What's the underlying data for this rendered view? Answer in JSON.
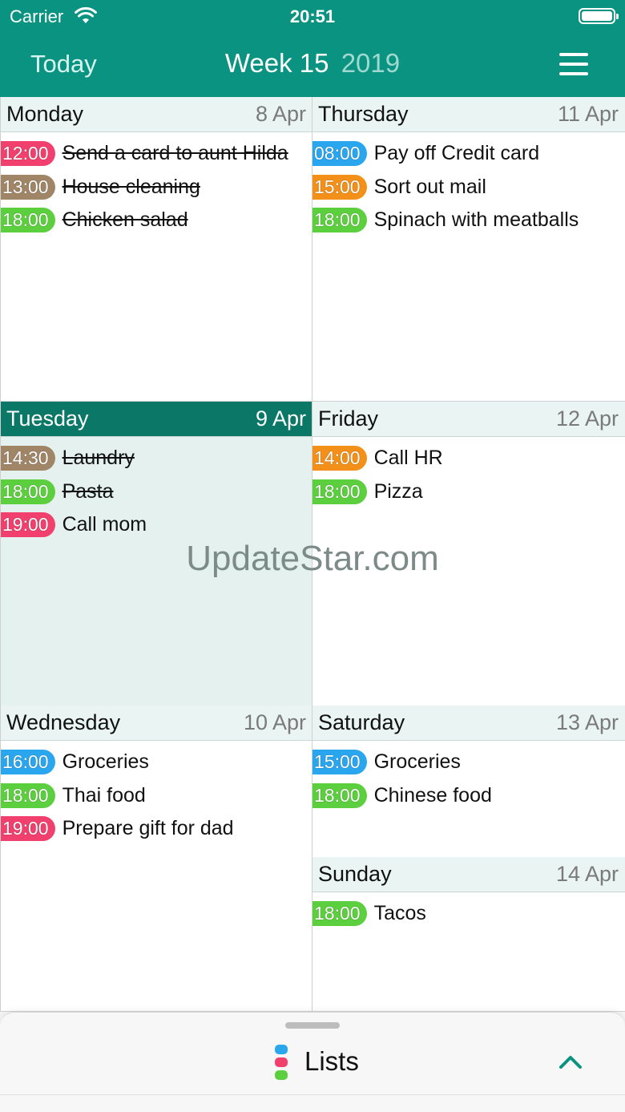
{
  "status_bar": {
    "carrier": "Carrier",
    "time": "20:51"
  },
  "nav": {
    "today": "Today",
    "week": "Week 15",
    "year": "2019"
  },
  "colors": {
    "header": "#0a9381",
    "selected_day": "#0a7767",
    "red": "#f2406e",
    "brown": "#a08566",
    "green": "#5ccf3e",
    "blue": "#2aa6ef",
    "orange": "#f39019",
    "accent": "#0a9381"
  },
  "days": [
    {
      "name": "Monday",
      "date": "8 Apr",
      "selected": false,
      "events": [
        {
          "time": "12:00",
          "title": "Send a card to aunt Hilda",
          "color": "#f2406e",
          "done": true
        },
        {
          "time": "13:00",
          "title": "House cleaning",
          "color": "#a08566",
          "done": true
        },
        {
          "time": "18:00",
          "title": "Chicken salad",
          "color": "#5ccf3e",
          "done": true
        }
      ]
    },
    {
      "name": "Tuesday",
      "date": "9 Apr",
      "selected": true,
      "events": [
        {
          "time": "14:30",
          "title": "Laundry",
          "color": "#a08566",
          "done": true
        },
        {
          "time": "18:00",
          "title": "Pasta",
          "color": "#5ccf3e",
          "done": true
        },
        {
          "time": "19:00",
          "title": "Call mom",
          "color": "#f2406e",
          "done": false
        }
      ]
    },
    {
      "name": "Wednesday",
      "date": "10 Apr",
      "selected": false,
      "events": [
        {
          "time": "16:00",
          "title": "Groceries",
          "color": "#2aa6ef",
          "done": false
        },
        {
          "time": "18:00",
          "title": "Thai food",
          "color": "#5ccf3e",
          "done": false
        },
        {
          "time": "19:00",
          "title": "Prepare gift for dad",
          "color": "#f2406e",
          "done": false
        }
      ]
    },
    {
      "name": "Thursday",
      "date": "11 Apr",
      "selected": false,
      "events": [
        {
          "time": "08:00",
          "title": "Pay off Credit card",
          "color": "#2aa6ef",
          "done": false
        },
        {
          "time": "15:00",
          "title": "Sort out mail",
          "color": "#f39019",
          "done": false
        },
        {
          "time": "18:00",
          "title": "Spinach with meatballs",
          "color": "#5ccf3e",
          "done": false
        }
      ]
    },
    {
      "name": "Friday",
      "date": "12 Apr",
      "selected": false,
      "events": [
        {
          "time": "14:00",
          "title": "Call HR",
          "color": "#f39019",
          "done": false
        },
        {
          "time": "18:00",
          "title": "Pizza",
          "color": "#5ccf3e",
          "done": false
        }
      ]
    },
    {
      "name": "Saturday",
      "date": "13 Apr",
      "selected": false,
      "events": [
        {
          "time": "15:00",
          "title": "Groceries",
          "color": "#2aa6ef",
          "done": false
        },
        {
          "time": "18:00",
          "title": "Chinese food",
          "color": "#5ccf3e",
          "done": false
        }
      ]
    },
    {
      "name": "Sunday",
      "date": "14 Apr",
      "selected": false,
      "events": [
        {
          "time": "18:00",
          "title": "Tacos",
          "color": "#5ccf3e",
          "done": false
        }
      ]
    }
  ],
  "watermark": "UpdateStar.com",
  "bottom_sheet": {
    "label": "Lists",
    "icon": "lists-icon",
    "chevron": "chevron-up-icon"
  }
}
